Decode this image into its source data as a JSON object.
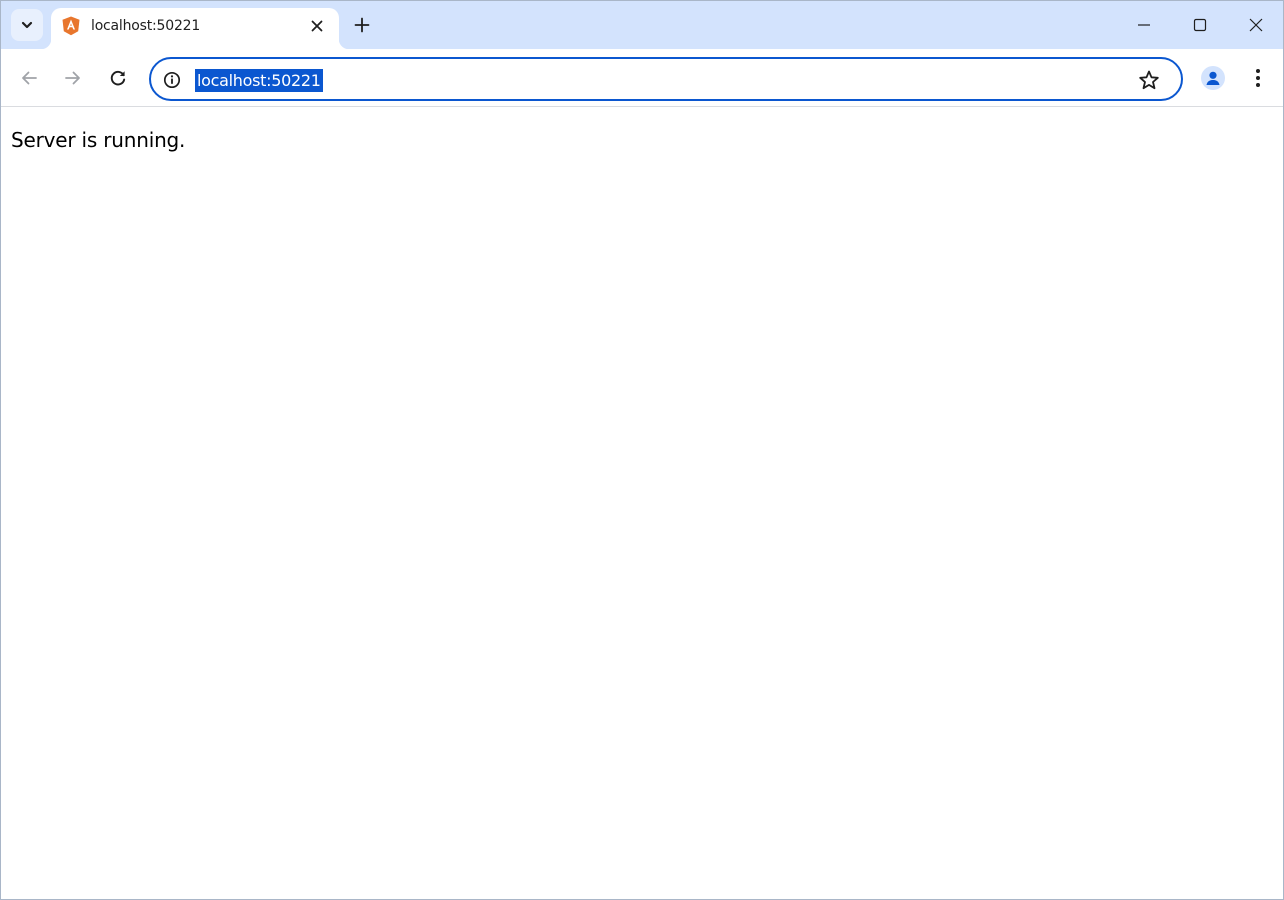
{
  "browser": {
    "tab": {
      "title": "localhost:50221"
    },
    "address_bar": {
      "url": "localhost:50221"
    }
  },
  "page": {
    "body_text": "Server is running."
  },
  "icons": {
    "tab_search": "chevron-down-icon",
    "favicon": "angular-icon",
    "tab_close": "close-icon",
    "new_tab": "plus-icon",
    "minimize": "minimize-icon",
    "maximize": "maximize-icon",
    "window_close": "close-icon",
    "back": "arrow-left-icon",
    "forward": "arrow-right-icon",
    "reload": "reload-icon",
    "site_info": "info-icon",
    "bookmark": "star-icon",
    "profile": "person-icon",
    "menu": "kebab-menu-icon"
  },
  "colors": {
    "tabstrip_bg": "#d3e3fd",
    "accent": "#0b57d0",
    "favicon": "#e8762d"
  }
}
